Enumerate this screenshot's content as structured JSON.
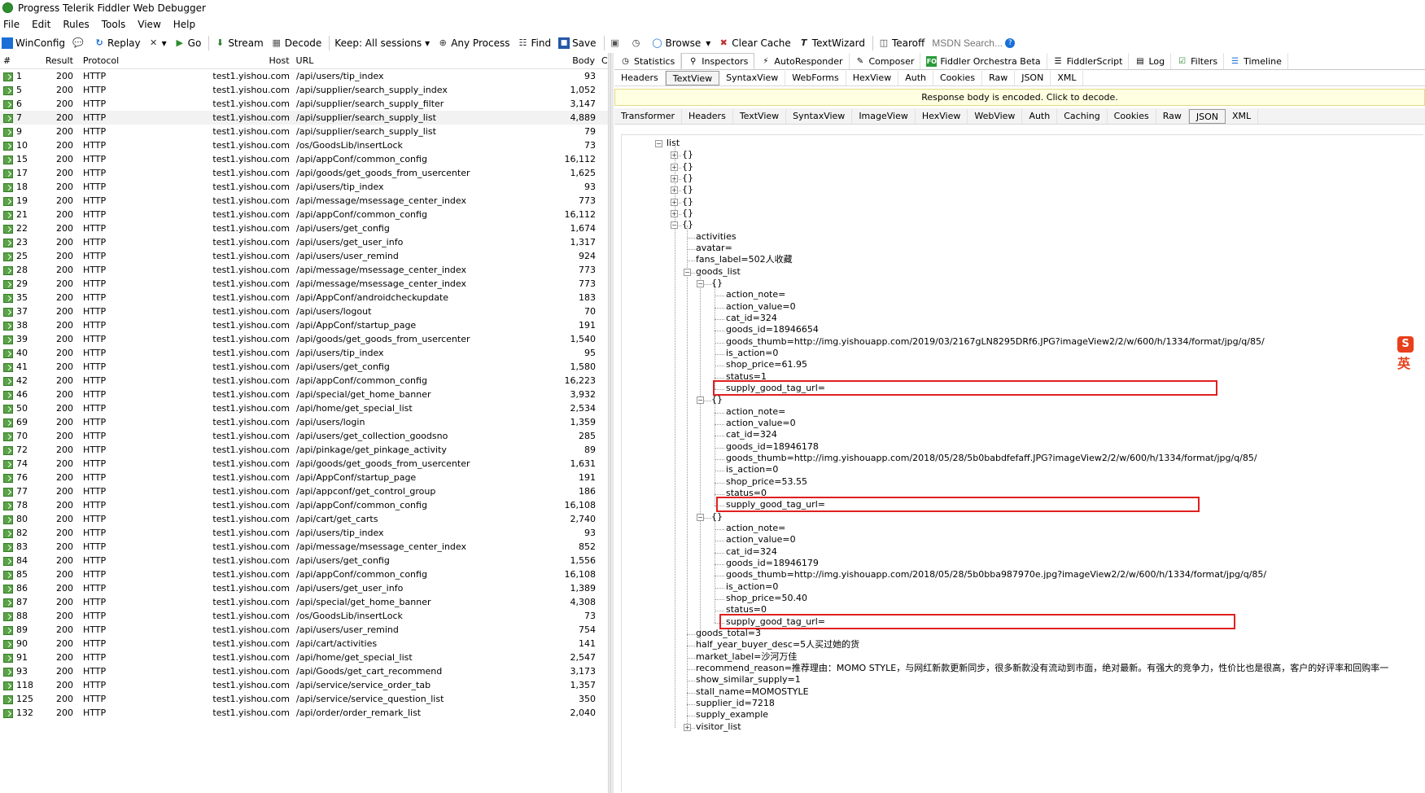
{
  "window": {
    "title": "Progress Telerik Fiddler Web Debugger"
  },
  "menu": [
    "File",
    "Edit",
    "Rules",
    "Tools",
    "View",
    "Help"
  ],
  "toolbar": {
    "winconfig": "WinConfig",
    "replay": "Replay",
    "x_label": "",
    "go": "Go",
    "stream": "Stream",
    "decode": "Decode",
    "keep": "Keep: All sessions",
    "any_process": "Any Process",
    "find": "Find",
    "save": "Save",
    "browse": "Browse",
    "clear_cache": "Clear Cache",
    "textwizard": "TextWizard",
    "tearoff": "Tearoff",
    "msdn_placeholder": "MSDN Search..."
  },
  "sessions": {
    "columns": [
      "#",
      "Result",
      "Protocol",
      "Host",
      "URL",
      "Body",
      "Ca"
    ],
    "rows": [
      [
        "1",
        "200",
        "HTTP",
        "test1.yishou.com",
        "/api/users/tip_index",
        "93"
      ],
      [
        "5",
        "200",
        "HTTP",
        "test1.yishou.com",
        "/api/supplier/search_supply_index",
        "1,052"
      ],
      [
        "6",
        "200",
        "HTTP",
        "test1.yishou.com",
        "/api/supplier/search_supply_filter",
        "3,147"
      ],
      [
        "7",
        "200",
        "HTTP",
        "test1.yishou.com",
        "/api/supplier/search_supply_list",
        "4,889"
      ],
      [
        "9",
        "200",
        "HTTP",
        "test1.yishou.com",
        "/api/supplier/search_supply_list",
        "79"
      ],
      [
        "10",
        "200",
        "HTTP",
        "test1.yishou.com",
        "/os/GoodsLib/insertLock",
        "73"
      ],
      [
        "15",
        "200",
        "HTTP",
        "test1.yishou.com",
        "/api/appConf/common_config",
        "16,112"
      ],
      [
        "17",
        "200",
        "HTTP",
        "test1.yishou.com",
        "/api/goods/get_goods_from_usercenter",
        "1,625"
      ],
      [
        "18",
        "200",
        "HTTP",
        "test1.yishou.com",
        "/api/users/tip_index",
        "93"
      ],
      [
        "19",
        "200",
        "HTTP",
        "test1.yishou.com",
        "/api/message/msessage_center_index",
        "773"
      ],
      [
        "21",
        "200",
        "HTTP",
        "test1.yishou.com",
        "/api/appConf/common_config",
        "16,112"
      ],
      [
        "22",
        "200",
        "HTTP",
        "test1.yishou.com",
        "/api/users/get_config",
        "1,674"
      ],
      [
        "23",
        "200",
        "HTTP",
        "test1.yishou.com",
        "/api/users/get_user_info",
        "1,317"
      ],
      [
        "25",
        "200",
        "HTTP",
        "test1.yishou.com",
        "/api/users/user_remind",
        "924"
      ],
      [
        "28",
        "200",
        "HTTP",
        "test1.yishou.com",
        "/api/message/msessage_center_index",
        "773"
      ],
      [
        "29",
        "200",
        "HTTP",
        "test1.yishou.com",
        "/api/message/msessage_center_index",
        "773"
      ],
      [
        "35",
        "200",
        "HTTP",
        "test1.yishou.com",
        "/api/AppConf/androidcheckupdate",
        "183"
      ],
      [
        "37",
        "200",
        "HTTP",
        "test1.yishou.com",
        "/api/users/logout",
        "70"
      ],
      [
        "38",
        "200",
        "HTTP",
        "test1.yishou.com",
        "/api/AppConf/startup_page",
        "191"
      ],
      [
        "39",
        "200",
        "HTTP",
        "test1.yishou.com",
        "/api/goods/get_goods_from_usercenter",
        "1,540"
      ],
      [
        "40",
        "200",
        "HTTP",
        "test1.yishou.com",
        "/api/users/tip_index",
        "95"
      ],
      [
        "41",
        "200",
        "HTTP",
        "test1.yishou.com",
        "/api/users/get_config",
        "1,580"
      ],
      [
        "42",
        "200",
        "HTTP",
        "test1.yishou.com",
        "/api/appConf/common_config",
        "16,223"
      ],
      [
        "46",
        "200",
        "HTTP",
        "test1.yishou.com",
        "/api/special/get_home_banner",
        "3,932"
      ],
      [
        "50",
        "200",
        "HTTP",
        "test1.yishou.com",
        "/api/home/get_special_list",
        "2,534"
      ],
      [
        "69",
        "200",
        "HTTP",
        "test1.yishou.com",
        "/api/users/login",
        "1,359"
      ],
      [
        "70",
        "200",
        "HTTP",
        "test1.yishou.com",
        "/api/users/get_collection_goodsno",
        "285"
      ],
      [
        "72",
        "200",
        "HTTP",
        "test1.yishou.com",
        "/api/pinkage/get_pinkage_activity",
        "89"
      ],
      [
        "74",
        "200",
        "HTTP",
        "test1.yishou.com",
        "/api/goods/get_goods_from_usercenter",
        "1,631"
      ],
      [
        "76",
        "200",
        "HTTP",
        "test1.yishou.com",
        "/api/AppConf/startup_page",
        "191"
      ],
      [
        "77",
        "200",
        "HTTP",
        "test1.yishou.com",
        "/api/appconf/get_control_group",
        "186"
      ],
      [
        "78",
        "200",
        "HTTP",
        "test1.yishou.com",
        "/api/appConf/common_config",
        "16,108"
      ],
      [
        "80",
        "200",
        "HTTP",
        "test1.yishou.com",
        "/api/cart/get_carts",
        "2,740"
      ],
      [
        "82",
        "200",
        "HTTP",
        "test1.yishou.com",
        "/api/users/tip_index",
        "93"
      ],
      [
        "83",
        "200",
        "HTTP",
        "test1.yishou.com",
        "/api/message/msessage_center_index",
        "852"
      ],
      [
        "84",
        "200",
        "HTTP",
        "test1.yishou.com",
        "/api/users/get_config",
        "1,556"
      ],
      [
        "85",
        "200",
        "HTTP",
        "test1.yishou.com",
        "/api/appConf/common_config",
        "16,108"
      ],
      [
        "86",
        "200",
        "HTTP",
        "test1.yishou.com",
        "/api/users/get_user_info",
        "1,389"
      ],
      [
        "87",
        "200",
        "HTTP",
        "test1.yishou.com",
        "/api/special/get_home_banner",
        "4,308"
      ],
      [
        "88",
        "200",
        "HTTP",
        "test1.yishou.com",
        "/os/GoodsLib/insertLock",
        "73"
      ],
      [
        "89",
        "200",
        "HTTP",
        "test1.yishou.com",
        "/api/users/user_remind",
        "754"
      ],
      [
        "90",
        "200",
        "HTTP",
        "test1.yishou.com",
        "/api/cart/activities",
        "141"
      ],
      [
        "91",
        "200",
        "HTTP",
        "test1.yishou.com",
        "/api/home/get_special_list",
        "2,547"
      ],
      [
        "93",
        "200",
        "HTTP",
        "test1.yishou.com",
        "/api/Goods/get_cart_recommend",
        "3,173"
      ],
      [
        "118",
        "200",
        "HTTP",
        "test1.yishou.com",
        "/api/service/service_order_tab",
        "1,357"
      ],
      [
        "125",
        "200",
        "HTTP",
        "test1.yishou.com",
        "/api/service/service_question_list",
        "350"
      ],
      [
        "132",
        "200",
        "HTTP",
        "test1.yishou.com",
        "/api/order/order_remark_list",
        "2,040"
      ]
    ],
    "selected_index": 3
  },
  "main_tabs": [
    "Statistics",
    "Inspectors",
    "AutoResponder",
    "Composer",
    "Fiddler Orchestra Beta",
    "FiddlerScript",
    "Log",
    "Filters",
    "Timeline"
  ],
  "main_tab_active": "Inspectors",
  "request_tabs": [
    "Headers",
    "TextView",
    "SyntaxView",
    "WebForms",
    "HexView",
    "Auth",
    "Cookies",
    "Raw",
    "JSON",
    "XML"
  ],
  "request_tab_active": "TextView",
  "encoded_banner": "Response body is encoded. Click to decode.",
  "response_tabs": [
    "Transformer",
    "Headers",
    "TextView",
    "SyntaxView",
    "ImageView",
    "HexView",
    "WebView",
    "Auth",
    "Caching",
    "Cookies",
    "Raw",
    "JSON",
    "XML"
  ],
  "response_tab_active": "JSON",
  "tree": {
    "list": "list",
    "brace": "{}",
    "shop": {
      "activities": "activities",
      "avatar": "avatar=",
      "fans_label": "fans_label=502人收藏",
      "goods_list": "goods_list",
      "goods_total": "goods_total=3",
      "half_year": "half_year_buyer_desc=5人买过她的货",
      "market_label": "market_label=沙河万佳",
      "recommend": "recommend_reason=推荐理由：MOMO STYLE，与网红新款更新同步，很多新款没有流动到市面，绝对最新。有强大的竞争力，性价比也是很高，客户的好评率和回购率一",
      "show_similar": "show_similar_supply=1",
      "stall_name": "stall_name=MOMOSTYLE",
      "supplier_id": "supplier_id=7218",
      "supply_example": "supply_example",
      "visitor_list": "visitor_list"
    },
    "goods": [
      {
        "action_note": "action_note=",
        "action_value": "action_value=0",
        "cat_id": "cat_id=324",
        "goods_id": "goods_id=18946654",
        "goods_thumb": "goods_thumb=http://img.yishouapp.com/2019/03/2167gLN8295DRf6.JPG?imageView2/2/w/600/h/1334/format/jpg/q/85/",
        "is_action": "is_action=0",
        "shop_price": "shop_price=61.95",
        "status": "status=1",
        "supply_good_tag_url": "supply_good_tag_url="
      },
      {
        "action_note": "action_note=",
        "action_value": "action_value=0",
        "cat_id": "cat_id=324",
        "goods_id": "goods_id=18946178",
        "goods_thumb": "goods_thumb=http://img.yishouapp.com/2018/05/28/5b0babdfefaff.JPG?imageView2/2/w/600/h/1334/format/jpg/q/85/",
        "is_action": "is_action=0",
        "shop_price": "shop_price=53.55",
        "status": "status=0",
        "supply_good_tag_url": "supply_good_tag_url="
      },
      {
        "action_note": "action_note=",
        "action_value": "action_value=0",
        "cat_id": "cat_id=324",
        "goods_id": "goods_id=18946179",
        "goods_thumb": "goods_thumb=http://img.yishouapp.com/2018/05/28/5b0bba987970e.jpg?imageView2/2/w/600/h/1334/format/jpg/q/85/",
        "is_action": "is_action=0",
        "shop_price": "shop_price=50.40",
        "status": "status=0",
        "supply_good_tag_url": "supply_good_tag_url="
      }
    ]
  },
  "sogou_badge": "S",
  "sogou_text": "英"
}
